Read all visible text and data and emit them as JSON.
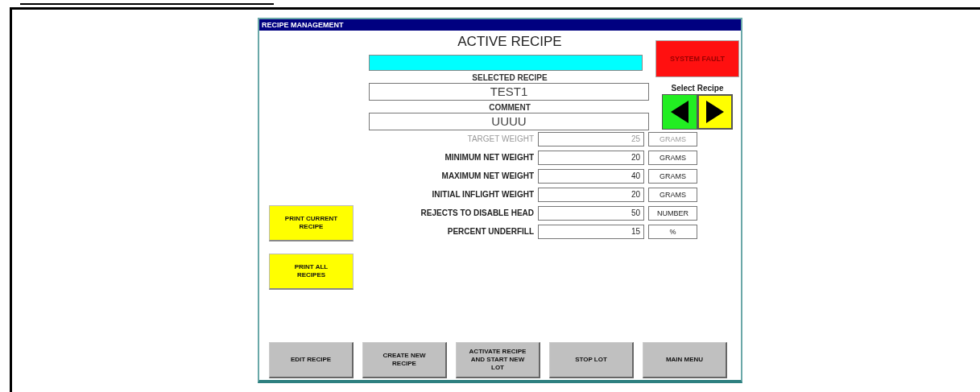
{
  "window": {
    "title": "RECIPE MANAGEMENT"
  },
  "active_recipe": {
    "heading": "ACTIVE RECIPE"
  },
  "system_fault": {
    "label": "SYSTEM FAULT"
  },
  "selected_recipe": {
    "label": "SELECTED RECIPE",
    "value": "TEST1"
  },
  "comment": {
    "label": "COMMENT",
    "value": "UUUU"
  },
  "select_recipe": {
    "label": "Select Recipe"
  },
  "parameters": [
    {
      "label": "TARGET WEIGHT",
      "value": "25",
      "unit": "GRAMS",
      "disabled": true
    },
    {
      "label": "MINIMUM NET WEIGHT",
      "value": "20",
      "unit": "GRAMS",
      "disabled": false
    },
    {
      "label": "MAXIMUM NET WEIGHT",
      "value": "40",
      "unit": "GRAMS",
      "disabled": false
    },
    {
      "label": "INITIAL INFLIGHT WEIGHT",
      "value": "20",
      "unit": "GRAMS",
      "disabled": false
    },
    {
      "label": "REJECTS TO DISABLE HEAD",
      "value": "50",
      "unit": "NUMBER",
      "disabled": false
    },
    {
      "label": "PERCENT UNDERFILL",
      "value": "15",
      "unit": "%",
      "disabled": false
    }
  ],
  "print_buttons": [
    "PRINT CURRENT RECIPE",
    "PRINT ALL RECIPES"
  ],
  "bottom_buttons": [
    "EDIT RECIPE",
    "CREATE NEW RECIPE",
    "ACTIVATE RECIPE AND START NEW LOT",
    "STOP LOT",
    "MAIN MENU"
  ]
}
